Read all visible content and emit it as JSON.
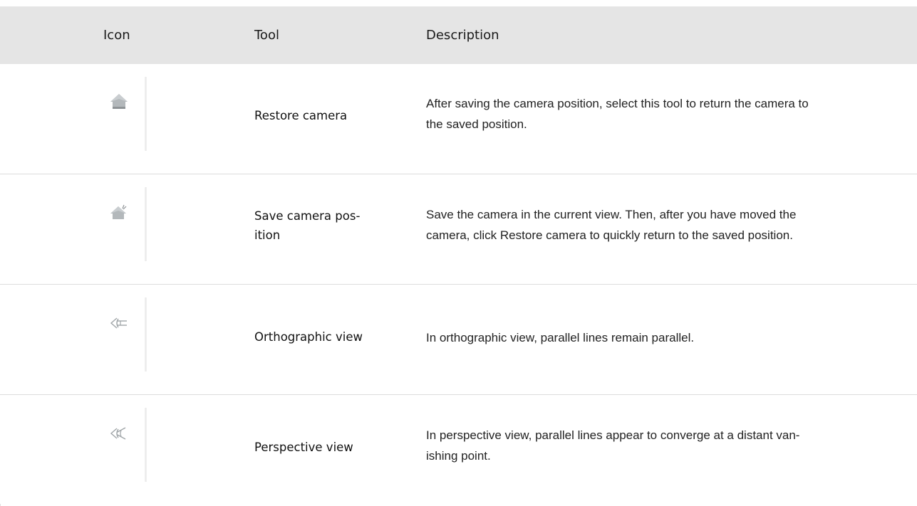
{
  "table": {
    "headers": {
      "icon": "Icon",
      "tool": "Tool",
      "description": "Description"
    },
    "rows": [
      {
        "icon": "home-camera-icon",
        "tool_line1": "Restore camera",
        "tool_line2": "",
        "desc_line1": "After saving the camera position, select this tool to return the camera to",
        "desc_line2": "the saved position."
      },
      {
        "icon": "save-camera-home-icon",
        "tool_line1": "Save camera pos-",
        "tool_line2": "ition",
        "desc_line1": "Save the camera in the current view. Then, after you have moved the",
        "desc_line2": "camera, click Restore camera to quickly return to the saved position."
      },
      {
        "icon": "orthographic-eye-icon",
        "tool_line1": "Orthographic view",
        "tool_line2": "",
        "desc_line1": "In orthographic view, parallel lines remain parallel.",
        "desc_line2": ""
      },
      {
        "icon": "perspective-eye-icon",
        "tool_line1": "Perspective view",
        "tool_line2": "",
        "desc_line1": "In perspective view, parallel lines appear to converge at a distant van-",
        "desc_line2": "ishing point."
      }
    ]
  },
  "colors": {
    "header_bg": "#e5e5e5",
    "icon_gray": "#a8adb0",
    "row_border": "#dcdcdc"
  }
}
